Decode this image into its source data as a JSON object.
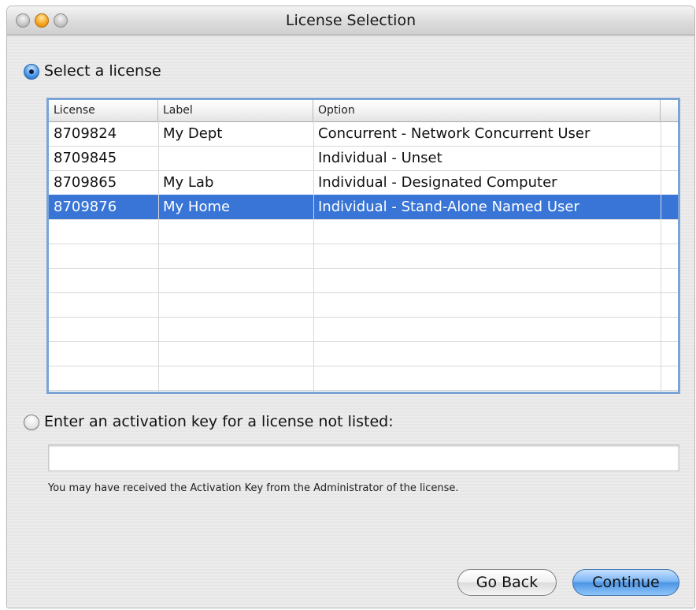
{
  "window": {
    "title": "License Selection"
  },
  "options": {
    "select_license_label": "Select a license",
    "activation_key_label": "Enter an activation key for a license not listed:"
  },
  "table": {
    "columns": [
      "License",
      "Label",
      "Option"
    ],
    "rows": [
      {
        "license": "8709824",
        "label": "My Dept",
        "option": "Concurrent - Network Concurrent User",
        "selected": false
      },
      {
        "license": "8709845",
        "label": "",
        "option": "Individual - Unset",
        "selected": false
      },
      {
        "license": "8709865",
        "label": "My Lab",
        "option": "Individual - Designated Computer",
        "selected": false
      },
      {
        "license": "8709876",
        "label": "My Home",
        "option": "Individual - Stand-Alone Named User",
        "selected": true
      }
    ]
  },
  "activation": {
    "value": "",
    "hint": "You may have received the Activation Key from the Administrator of the license."
  },
  "buttons": {
    "back": "Go Back",
    "continue": "Continue"
  },
  "colors": {
    "selection": "#3875d7",
    "default_button": "#4d95e3"
  }
}
